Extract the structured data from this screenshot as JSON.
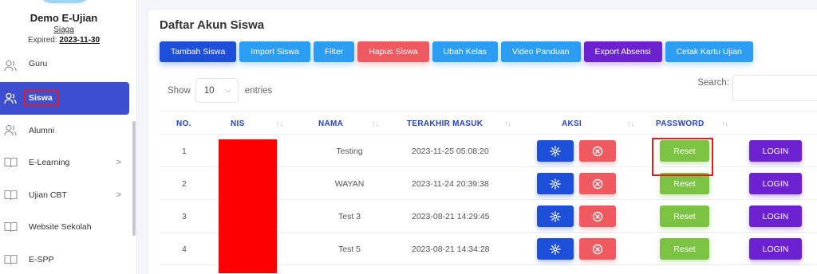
{
  "sidebar": {
    "school_name": "Demo E-Ujian",
    "plan": "Siaga",
    "expired_label": "Expired:",
    "expired_date": "2023-11-30",
    "items": [
      {
        "label": "Guru",
        "icon": "users-icon"
      },
      {
        "label": "Siswa",
        "icon": "users-icon",
        "active": true
      },
      {
        "label": "Alumni",
        "icon": "users-icon"
      },
      {
        "label": "E-Learning",
        "icon": "book-icon",
        "chevron": ">"
      },
      {
        "label": "Ujian CBT",
        "icon": "book-icon",
        "chevron": ">"
      },
      {
        "label": "Website Sekolah",
        "icon": "book-icon"
      },
      {
        "label": "E-SPP",
        "icon": "book-icon"
      }
    ]
  },
  "card": {
    "title": "Daftar Akun Siswa"
  },
  "toolbar": {
    "buttons": [
      {
        "label": "Tambah Siswa",
        "color": "#1e4fd8"
      },
      {
        "label": "Import Siswa",
        "color": "#2b9ef3"
      },
      {
        "label": "Filter",
        "color": "#2b9ef3"
      },
      {
        "label": "Hapus Siswa",
        "color": "#ee5a5f"
      },
      {
        "label": "Ubah Kelas",
        "color": "#2b9ef3"
      },
      {
        "label": "Video Panduan",
        "color": "#2b9ef3"
      },
      {
        "label": "Export Absensi",
        "color": "#6c22d0"
      },
      {
        "label": "Cetak Kartu Ujian",
        "color": "#2b9ef3"
      }
    ]
  },
  "table_controls": {
    "show_label": "Show",
    "length_value": "10",
    "entries_label": "entries",
    "search_label": "Search:",
    "search_value": ""
  },
  "table": {
    "headers": [
      "NO.",
      "NIS",
      "NAMA",
      "TERAKHIR MASUK",
      "AKSI",
      "PASSWORD"
    ],
    "rows": [
      {
        "no": "1",
        "nama": "Testing",
        "terakhir_masuk": "2023-11-25 05:08:20",
        "reset": "Reset",
        "login": "LOGIN"
      },
      {
        "no": "2",
        "nama": "WAYAN",
        "terakhir_masuk": "2023-11-24 20:39:38",
        "reset": "Reset",
        "login": "LOGIN"
      },
      {
        "no": "3",
        "nama": "Test 3",
        "terakhir_masuk": "2023-08-21 14:29:45",
        "reset": "Reset",
        "login": "LOGIN"
      },
      {
        "no": "4",
        "nama": "Test 5",
        "terakhir_masuk": "2023-08-21 14:34:28",
        "reset": "Reset",
        "login": "LOGIN"
      }
    ]
  },
  "colors": {
    "accent": "#3d4fd0",
    "highlight": "#e02020",
    "redaction": "#ff0000"
  }
}
